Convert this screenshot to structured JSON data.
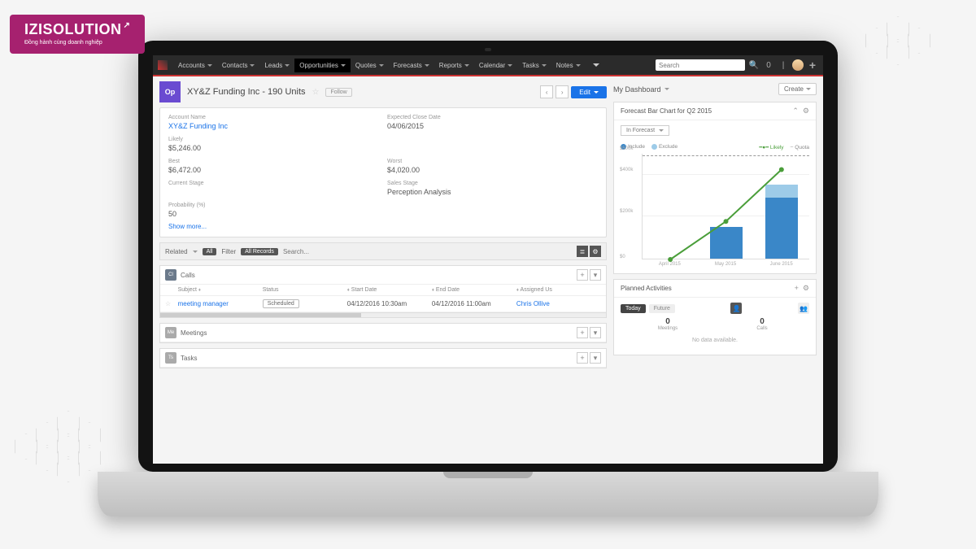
{
  "brand": {
    "name": "IZISOLUTION",
    "tagline": "Đồng hành cùng doanh nghiệp"
  },
  "nav": {
    "items": [
      "Accounts",
      "Contacts",
      "Leads",
      "Opportunities",
      "Quotes",
      "Forecasts",
      "Reports",
      "Calendar",
      "Tasks",
      "Notes"
    ],
    "active": "Opportunities",
    "search_placeholder": "Search"
  },
  "record": {
    "module_icon": "Op",
    "title": "XY&Z Funding Inc - 190 Units",
    "follow": "Follow",
    "edit": "Edit",
    "fields": {
      "account_name": {
        "label": "Account Name",
        "value": "XY&Z Funding Inc"
      },
      "expected_close": {
        "label": "Expected Close Date",
        "value": "04/06/2015"
      },
      "likely": {
        "label": "Likely",
        "value": "$5,246.00"
      },
      "best": {
        "label": "Best",
        "value": "$6,472.00"
      },
      "worst": {
        "label": "Worst",
        "value": "$4,020.00"
      },
      "current_stage": {
        "label": "Current Stage",
        "value": ""
      },
      "sales_stage": {
        "label": "Sales Stage",
        "value": "Perception Analysis"
      },
      "probability": {
        "label": "Probability (%)",
        "value": "50"
      }
    },
    "show_more": "Show more..."
  },
  "related": {
    "label": "Related",
    "all": "All",
    "filter": "Filter",
    "all_records": "All Records",
    "search_placeholder": "Search...",
    "panels": {
      "calls": {
        "badge": "Cl",
        "title": "Calls",
        "columns": [
          "Subject",
          "Status",
          "Start Date",
          "End Date",
          "Assigned Us"
        ],
        "rows": [
          {
            "subject": "meeting manager",
            "status": "Scheduled",
            "start": "04/12/2016 10:30am",
            "end": "04/12/2016 11:00am",
            "assigned": "Chris Ollive"
          }
        ]
      },
      "meetings": {
        "badge": "Me",
        "title": "Meetings"
      },
      "tasks": {
        "badge": "Ts",
        "title": "Tasks"
      }
    }
  },
  "dashboard": {
    "title": "My Dashboard",
    "create": "Create",
    "forecast": {
      "title": "Forecast Bar Chart for Q2 2015",
      "dropdown": "In Forecast",
      "legend": {
        "include": "Include",
        "exclude": "Exclude",
        "likely": "Likely",
        "quota": "Quota"
      }
    },
    "planned": {
      "title": "Planned Activities",
      "today": "Today",
      "future": "Future",
      "meetings": {
        "count": "0",
        "label": "Meetings"
      },
      "calls": {
        "count": "0",
        "label": "Calls"
      },
      "empty": "No data available."
    }
  },
  "chart_data": {
    "type": "bar",
    "title": "Forecast Bar Chart for Q2 2015",
    "categories": [
      "April 2015",
      "May 2015",
      "June 2015"
    ],
    "series": [
      {
        "name": "Include",
        "color": "#3a87c8",
        "values": [
          0,
          150000,
          290000
        ]
      },
      {
        "name": "Exclude",
        "color": "#9dcbe8",
        "values": [
          0,
          0,
          60000
        ]
      },
      {
        "name": "Likely",
        "type": "line",
        "color": "#4a9e3a",
        "values": [
          0,
          180000,
          425000
        ]
      }
    ],
    "quota": 490000,
    "ylabel": "",
    "ylim": [
      0,
      500000
    ],
    "yticks": [
      "$0",
      "$200k",
      "$400k",
      "$500k"
    ]
  }
}
